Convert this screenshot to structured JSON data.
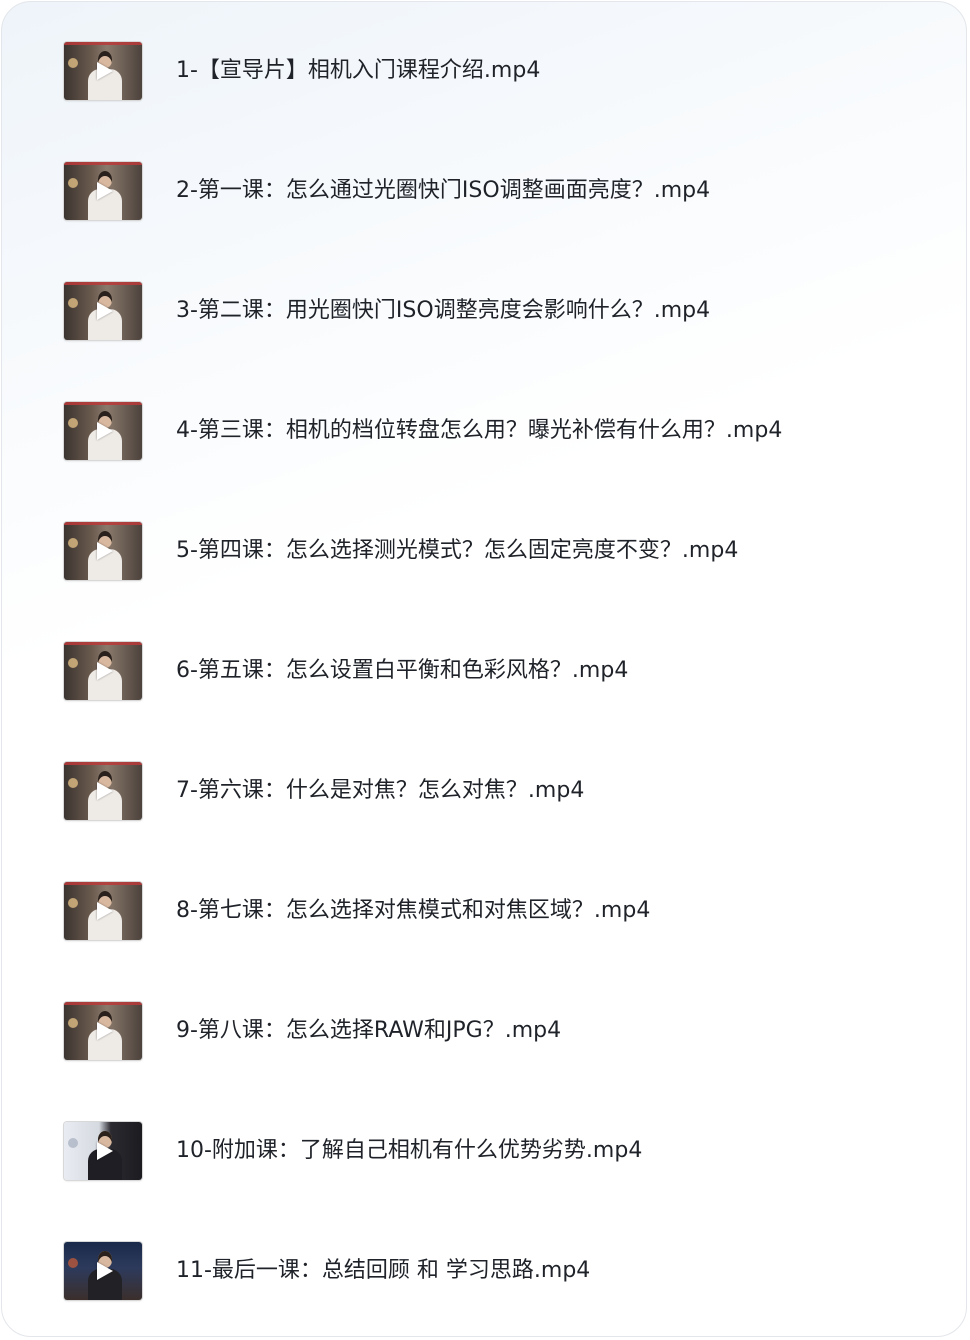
{
  "files": [
    {
      "name": "1-【宣导片】相机入门课程介绍.mp4",
      "thumb": "video-thumbnail-icon"
    },
    {
      "name": "2-第一课：怎么通过光圈快门ISO调整画面亮度？.mp4",
      "thumb": "video-thumbnail-icon"
    },
    {
      "name": "3-第二课：用光圈快门ISO调整亮度会影响什么？.mp4",
      "thumb": "video-thumbnail-icon"
    },
    {
      "name": "4-第三课：相机的档位转盘怎么用？曝光补偿有什么用？.mp4",
      "thumb": "video-thumbnail-icon"
    },
    {
      "name": "5-第四课：怎么选择测光模式？怎么固定亮度不变？.mp4",
      "thumb": "video-thumbnail-icon"
    },
    {
      "name": "6-第五课：怎么设置白平衡和色彩风格？.mp4",
      "thumb": "video-thumbnail-icon"
    },
    {
      "name": "7-第六课：什么是对焦？怎么对焦？.mp4",
      "thumb": "video-thumbnail-icon"
    },
    {
      "name": "8-第七课：怎么选择对焦模式和对焦区域？.mp4",
      "thumb": "video-thumbnail-icon"
    },
    {
      "name": "9-第八课：怎么选择RAW和JPG？.mp4",
      "thumb": "video-thumbnail-icon"
    },
    {
      "name": "10-附加课：了解自己相机有什么优势劣势.mp4",
      "thumb": "video-thumbnail-icon"
    },
    {
      "name": "11-最后一课：总结回顾 和 学习思路.mp4",
      "thumb": "video-thumbnail-icon"
    }
  ]
}
